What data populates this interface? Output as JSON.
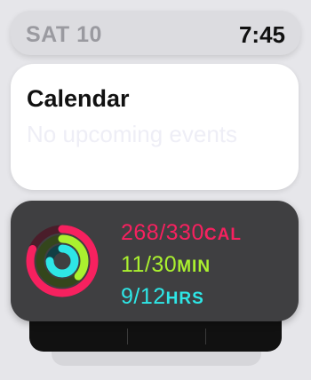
{
  "status": {
    "date": "SAT 10",
    "time": "7:45"
  },
  "calendar": {
    "title": "Calendar",
    "subtitle": "No upcoming events"
  },
  "activity": {
    "move": {
      "value": "268/330",
      "unit": "CAL",
      "progress": 0.81,
      "color": "#f6215f"
    },
    "exercise": {
      "value": "11/30",
      "unit": "MIN",
      "progress": 0.37,
      "color": "#aaf02f"
    },
    "stand": {
      "value": "9/12",
      "unit": "HRS",
      "progress": 0.75,
      "color": "#2ee6e6"
    }
  }
}
